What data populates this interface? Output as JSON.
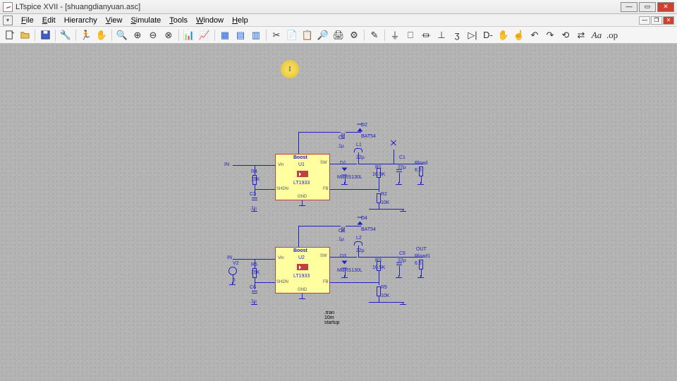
{
  "title": "LTspice XVII - [shuangdianyuan.asc]",
  "menus": {
    "file": "File",
    "edit": "Edit",
    "hierarchy": "Hierarchy",
    "view": "View",
    "simulate": "Simulate",
    "tools": "Tools",
    "window": "Window",
    "help": "Help"
  },
  "directive": ".tran 10m startup",
  "chip1": {
    "title": "Boost",
    "ref": "U1",
    "part": "LT1933",
    "pins": {
      "vin": "Vin",
      "sw": "SW",
      "shdn": "SHDN",
      "fb": "FB",
      "gnd": "GND"
    }
  },
  "chip2": {
    "title": "Boost",
    "ref": "U2",
    "part": "LT1933",
    "pins": {
      "vin": "Vin",
      "sw": "SW",
      "shdn": "SHDN",
      "fb": "FB",
      "gnd": "GND"
    }
  },
  "labels": {
    "in": "IN",
    "out": "OUT",
    "r4": "R4",
    "r4v": "15K",
    "c3": "C3",
    "c3v": ".1µ",
    "c2": "C2",
    "c2v": ".1µ",
    "d2": "D2",
    "bat54a": "BAT54",
    "l1": "L1",
    "l1v": "22µ",
    "d1": "D1",
    "mbra": "MBRS130L",
    "r1": "R1",
    "r1v": "16.5K",
    "c1": "C1",
    "c1v": "22µ",
    "rload": "Rload",
    "rloadv": "6.6",
    "r2": "R2",
    "r2v": "10K",
    "v2": "V2",
    "v2v": "5",
    "r6": "R6",
    "r6v": "15K",
    "c6": "C6",
    "c6v": ".1µ",
    "c4": "C4",
    "c4v": ".1µ",
    "d4": "D4",
    "bat54b": "BAT54",
    "l2": "L2",
    "l2v": "22µ",
    "d3": "D3",
    "mbrb": "MBRS130L",
    "r3": "R3",
    "r3v": "16.5K",
    "c5": "C5",
    "c5v": "22µ",
    "rload1": "Rload1",
    "rload1v": "6.6",
    "r5": "R5",
    "r5v": "10K"
  }
}
